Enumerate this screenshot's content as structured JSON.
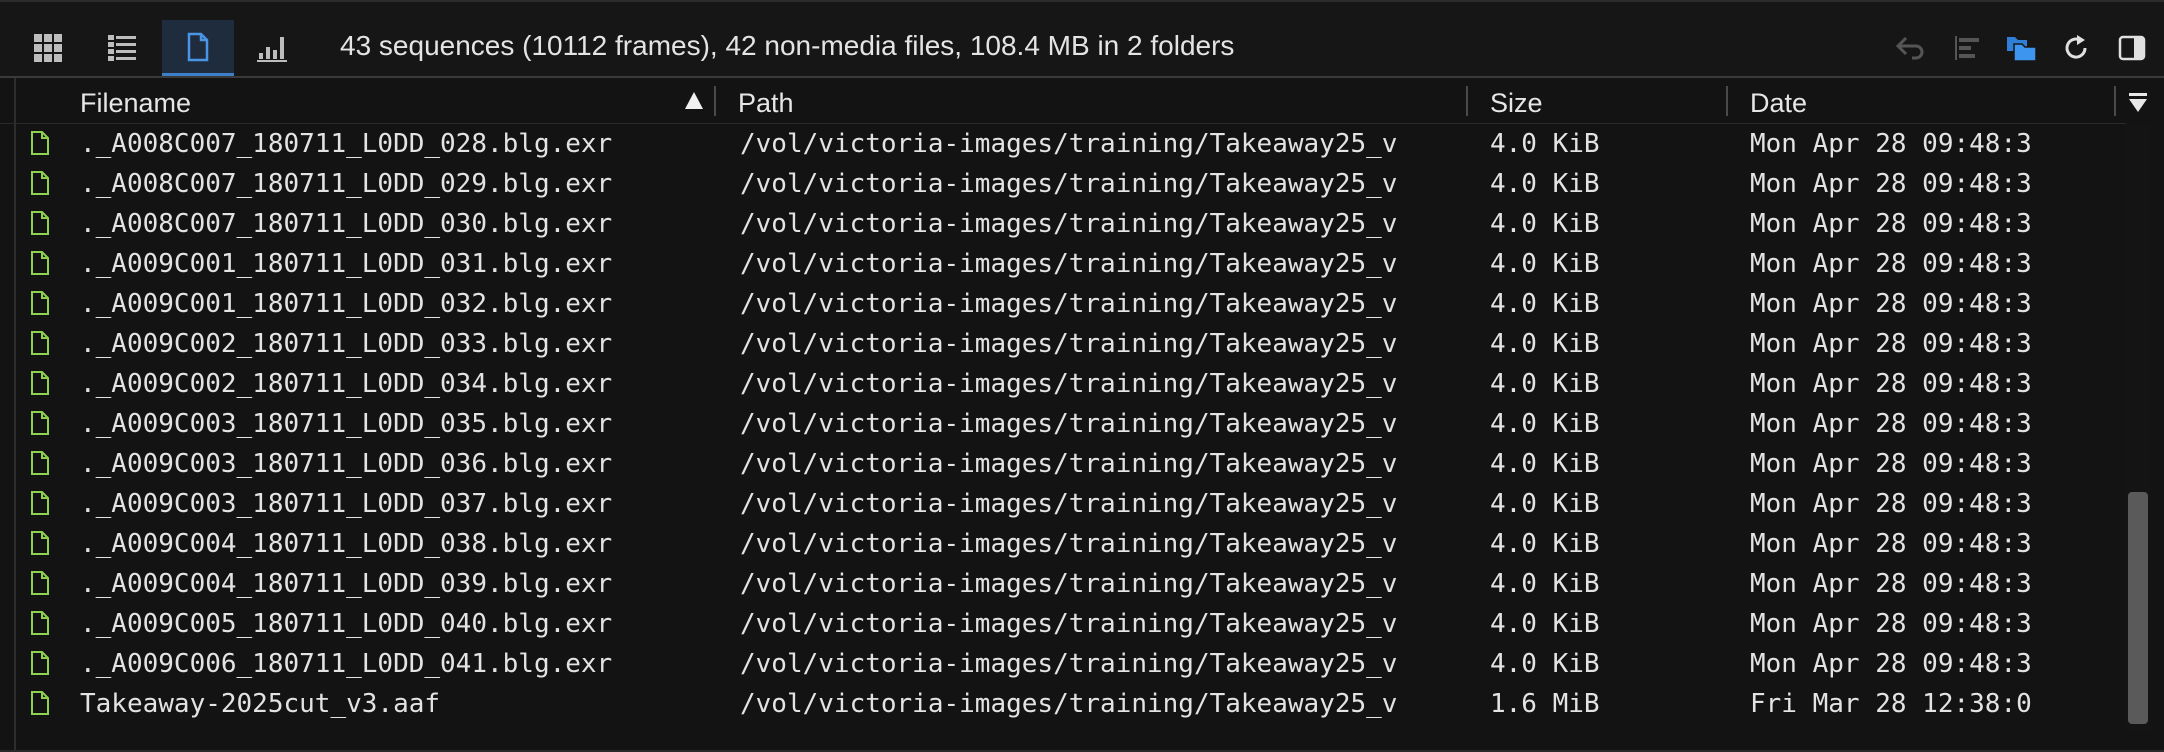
{
  "toolbar": {
    "views": [
      {
        "name": "grid-large-view",
        "icon": "grid-large-icon",
        "active": false
      },
      {
        "name": "grid-list-view",
        "icon": "grid-list-icon",
        "active": false
      },
      {
        "name": "file-list-view",
        "icon": "file-icon",
        "active": true
      },
      {
        "name": "stats-view",
        "icon": "bar-chart-icon",
        "active": false
      }
    ],
    "summary": "43 sequences (10112 frames), 42 non-media files, 108.4 MB in 2 folders",
    "right_icons": [
      "link-back-icon",
      "align-left-icon",
      "copy-to-folder-icon",
      "refresh-icon",
      "panel-toggle-icon"
    ]
  },
  "columns": {
    "filename": "Filename",
    "path": "Path",
    "size": "Size",
    "date": "Date"
  },
  "rows": [
    {
      "name": "._A008C007_180711_L0DD_028.blg.exr",
      "path": "/vol/victoria-images/training/Takeaway25_v",
      "size": "4.0 KiB",
      "date": "Mon Apr 28 09:48:3"
    },
    {
      "name": "._A008C007_180711_L0DD_029.blg.exr",
      "path": "/vol/victoria-images/training/Takeaway25_v",
      "size": "4.0 KiB",
      "date": "Mon Apr 28 09:48:3"
    },
    {
      "name": "._A008C007_180711_L0DD_030.blg.exr",
      "path": "/vol/victoria-images/training/Takeaway25_v",
      "size": "4.0 KiB",
      "date": "Mon Apr 28 09:48:3"
    },
    {
      "name": "._A009C001_180711_L0DD_031.blg.exr",
      "path": "/vol/victoria-images/training/Takeaway25_v",
      "size": "4.0 KiB",
      "date": "Mon Apr 28 09:48:3"
    },
    {
      "name": "._A009C001_180711_L0DD_032.blg.exr",
      "path": "/vol/victoria-images/training/Takeaway25_v",
      "size": "4.0 KiB",
      "date": "Mon Apr 28 09:48:3"
    },
    {
      "name": "._A009C002_180711_L0DD_033.blg.exr",
      "path": "/vol/victoria-images/training/Takeaway25_v",
      "size": "4.0 KiB",
      "date": "Mon Apr 28 09:48:3"
    },
    {
      "name": "._A009C002_180711_L0DD_034.blg.exr",
      "path": "/vol/victoria-images/training/Takeaway25_v",
      "size": "4.0 KiB",
      "date": "Mon Apr 28 09:48:3"
    },
    {
      "name": "._A009C003_180711_L0DD_035.blg.exr",
      "path": "/vol/victoria-images/training/Takeaway25_v",
      "size": "4.0 KiB",
      "date": "Mon Apr 28 09:48:3"
    },
    {
      "name": "._A009C003_180711_L0DD_036.blg.exr",
      "path": "/vol/victoria-images/training/Takeaway25_v",
      "size": "4.0 KiB",
      "date": "Mon Apr 28 09:48:3"
    },
    {
      "name": "._A009C003_180711_L0DD_037.blg.exr",
      "path": "/vol/victoria-images/training/Takeaway25_v",
      "size": "4.0 KiB",
      "date": "Mon Apr 28 09:48:3"
    },
    {
      "name": "._A009C004_180711_L0DD_038.blg.exr",
      "path": "/vol/victoria-images/training/Takeaway25_v",
      "size": "4.0 KiB",
      "date": "Mon Apr 28 09:48:3"
    },
    {
      "name": "._A009C004_180711_L0DD_039.blg.exr",
      "path": "/vol/victoria-images/training/Takeaway25_v",
      "size": "4.0 KiB",
      "date": "Mon Apr 28 09:48:3"
    },
    {
      "name": "._A009C005_180711_L0DD_040.blg.exr",
      "path": "/vol/victoria-images/training/Takeaway25_v",
      "size": "4.0 KiB",
      "date": "Mon Apr 28 09:48:3"
    },
    {
      "name": "._A009C006_180711_L0DD_041.blg.exr",
      "path": "/vol/victoria-images/training/Takeaway25_v",
      "size": "4.0 KiB",
      "date": "Mon Apr 28 09:48:3"
    },
    {
      "name": "Takeaway-2025cut_v3.aaf",
      "path": "/vol/victoria-images/training/Takeaway25_v",
      "size": "1.6 MiB",
      "date": "Fri Mar 28 12:38:0"
    }
  ],
  "sort": {
    "column": "filename",
    "direction": "ascending"
  },
  "colors": {
    "background": "#131313",
    "accent": "#3d7fc9",
    "file_icon": "#8fd14f",
    "text": "#e3e3e3"
  }
}
